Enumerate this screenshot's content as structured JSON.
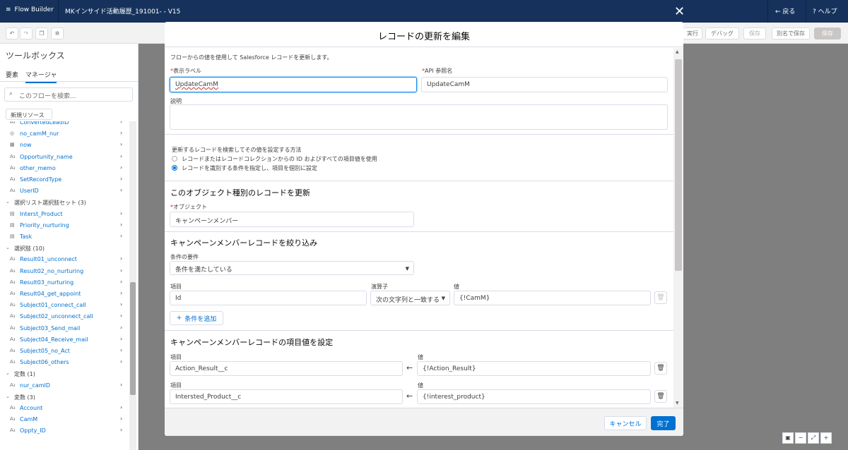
{
  "topbar": {
    "brand": "Flow Builder",
    "flow_name": "MKインサイド活動履歴_191001- - V15",
    "back": "戻る",
    "help": "ヘルプ"
  },
  "toolbar": {
    "run": "実行",
    "debug": "デバッグ",
    "check": "保存",
    "save_as": "別名で保存",
    "save": "保存"
  },
  "toolbox": {
    "title": "ツールボックス",
    "tab_elements": "要素",
    "tab_manager": "マネージャ",
    "search_placeholder": "このフローを検索...",
    "new_resource": "新規リソース",
    "items": [
      {
        "label": "ConvertedLeadID",
        "type": "var",
        "group": false
      },
      {
        "label": "no_camM_nur",
        "type": "bool",
        "group": false
      },
      {
        "label": "now",
        "type": "date",
        "group": false
      },
      {
        "label": "Opportunity_name",
        "type": "text",
        "group": false
      },
      {
        "label": "other_memo",
        "type": "text",
        "group": false
      },
      {
        "label": "SetRecordType",
        "type": "text",
        "group": false
      },
      {
        "label": "UserID",
        "type": "text",
        "group": false
      },
      {
        "label": "選択リスト選択肢セット (3)",
        "type": "chevron",
        "group": true
      },
      {
        "label": "Interst_Product",
        "type": "list",
        "group": false
      },
      {
        "label": "Priority_nurturing",
        "type": "list",
        "group": false
      },
      {
        "label": "Task",
        "type": "list",
        "group": false
      },
      {
        "label": "選択肢 (10)",
        "type": "chevron",
        "group": true
      },
      {
        "label": "Result01_unconnect",
        "type": "text",
        "group": false
      },
      {
        "label": "Result02_no_nurturing",
        "type": "text",
        "group": false
      },
      {
        "label": "Result03_nurturing",
        "type": "text",
        "group": false
      },
      {
        "label": "Result04_get_appoint",
        "type": "text",
        "group": false
      },
      {
        "label": "Subject01_connect_call",
        "type": "text",
        "group": false
      },
      {
        "label": "Subject02_unconnect_call",
        "type": "text",
        "group": false
      },
      {
        "label": "Subject03_Send_mail",
        "type": "text",
        "group": false
      },
      {
        "label": "Subject04_Receive_mail",
        "type": "text",
        "group": false
      },
      {
        "label": "Subject05_no_Act",
        "type": "text",
        "group": false
      },
      {
        "label": "Subject06_others",
        "type": "text",
        "group": false
      },
      {
        "label": "定数 (1)",
        "type": "chevron",
        "group": true
      },
      {
        "label": "nur_camID",
        "type": "text",
        "group": false
      },
      {
        "label": "変数 (3)",
        "type": "chevron",
        "group": true
      },
      {
        "label": "Account",
        "type": "text",
        "group": false
      },
      {
        "label": "CamM",
        "type": "text",
        "group": false
      },
      {
        "label": "Oppty_ID",
        "type": "text",
        "group": false
      }
    ]
  },
  "modal": {
    "title": "レコードの更新を編集",
    "intro": "フローからの値を使用して Salesforce レコードを更新します。",
    "label_field": {
      "label": "表示ラベル",
      "value": "UpdateCamM"
    },
    "api_field": {
      "label": "API 参照名",
      "value": "UpdateCamM"
    },
    "description": {
      "label": "説明",
      "value": ""
    },
    "method": {
      "label": "更新するレコードを検索してその値を設定する方法",
      "opt1": "レコードまたはレコードコレクションからの ID およびすべての項目値を使用",
      "opt2": "レコードを識別する条件を指定し、項目を個別に設定"
    },
    "object_section": {
      "title": "このオブジェクト種別のレコードを更新",
      "label": "オブジェクト",
      "value": "キャンペーンメンバー"
    },
    "filter_section": {
      "title": "キャンペーンメンバーレコードを絞り込み",
      "cond_label": "条件の要件",
      "cond_value": "条件を満たしている",
      "field_label": "項目",
      "op_label": "演算子",
      "value_label": "値",
      "field_value": "Id",
      "op_value": "次の文字列と一致する",
      "value_value": "{!CamM}",
      "add": "条件を追加"
    },
    "set_section": {
      "title": "キャンペーンメンバーレコードの項目値を設定",
      "rows": [
        {
          "field_label": "項目",
          "field": "Action_Result__c",
          "value_label": "値",
          "value": "{!Action_Result}"
        },
        {
          "field_label": "項目",
          "field": "Intersted_Product__c",
          "value_label": "値",
          "value": "{!interest_product}"
        }
      ]
    },
    "cancel": "キャンセル",
    "done": "完了"
  }
}
